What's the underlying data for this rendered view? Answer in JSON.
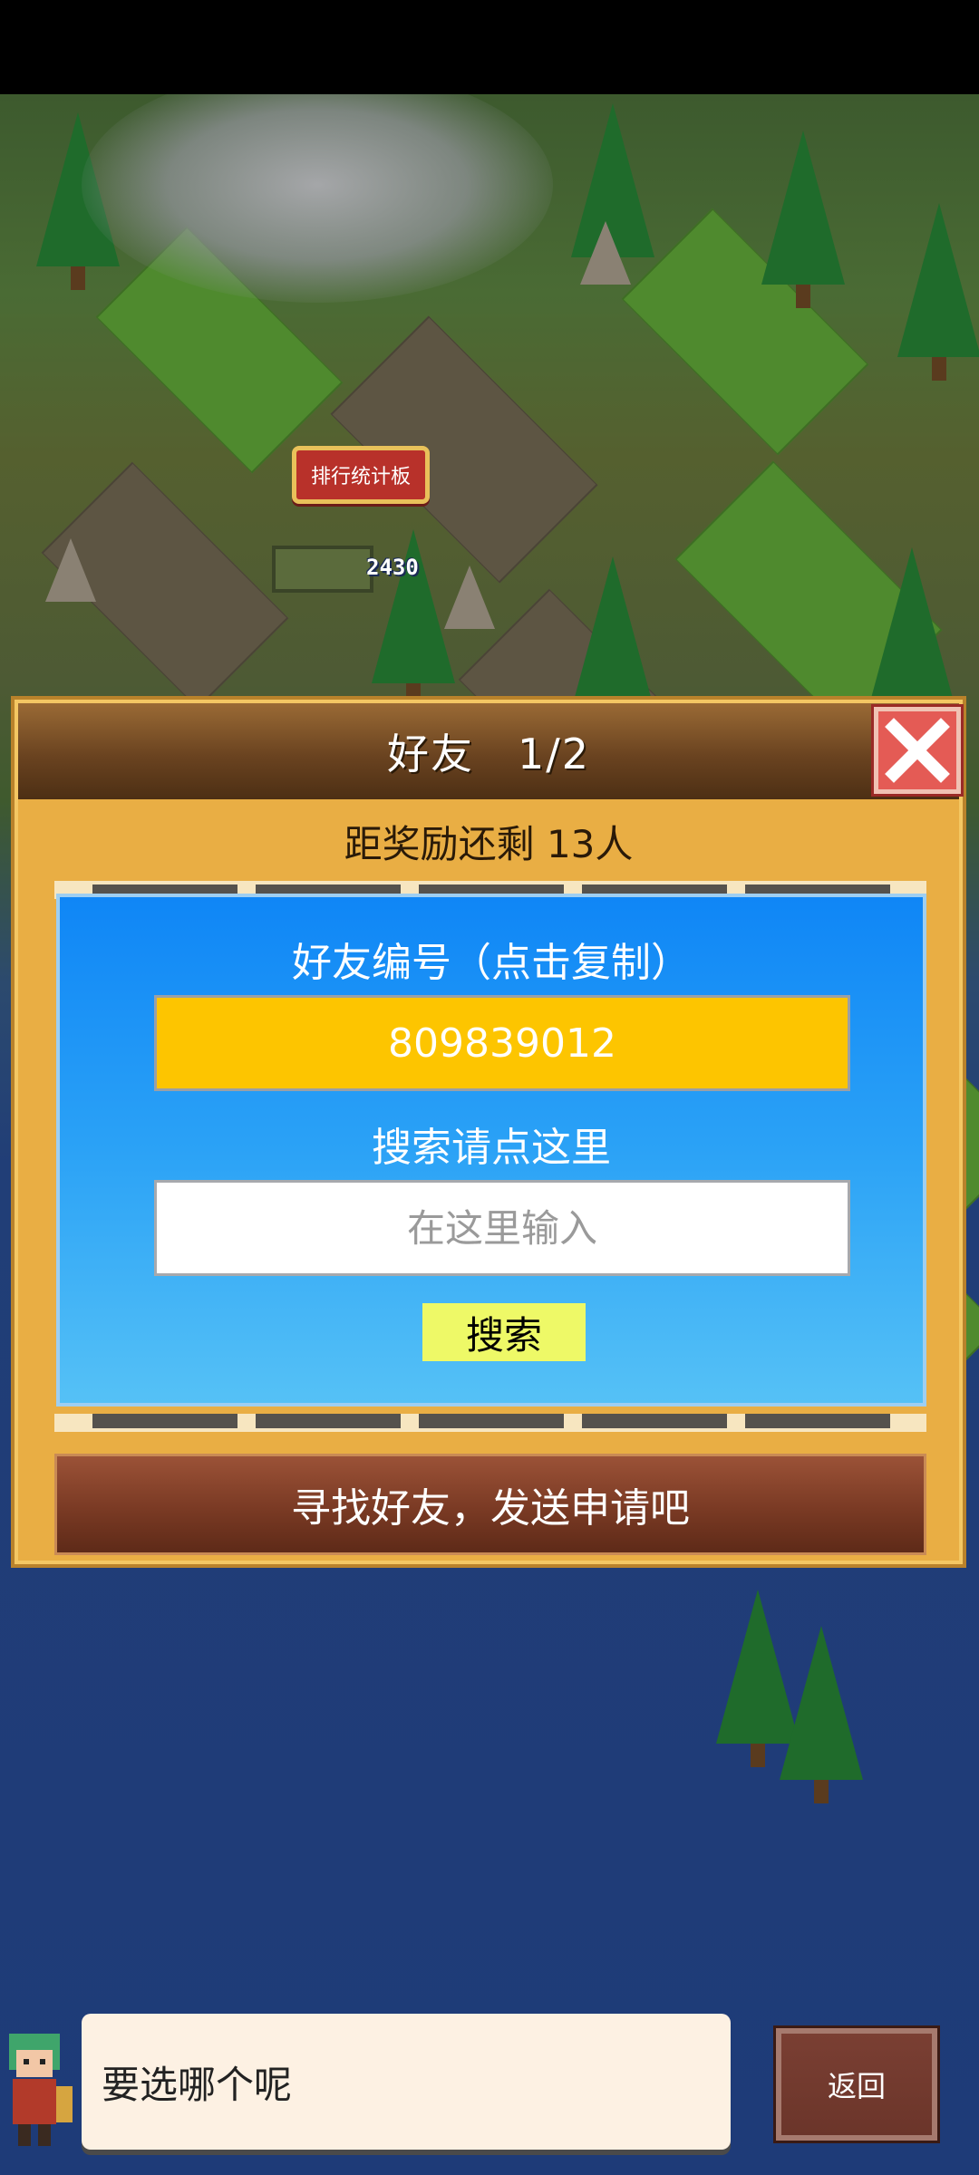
{
  "map": {
    "leaderboard_sign": "排行统计板",
    "score": "2430"
  },
  "dialog": {
    "title": "好友　1/2",
    "reward_text": "距奖励还剩 13人",
    "friend_id_label": "好友编号（点击复制）",
    "friend_id": "809839012",
    "search_label": "搜索请点这里",
    "search_placeholder": "在这里输入",
    "search_value": "",
    "search_button": "搜索",
    "find_friends_button": "寻找好友，发送申请吧"
  },
  "bottom": {
    "speech": "要选哪个呢",
    "back_button": "返回"
  },
  "colors": {
    "dialog_bg": "#e9ae44",
    "panel_blue": "#1a8ff6",
    "friend_id_yellow": "#fdc500",
    "search_button": "#eef967",
    "close_red": "#e45b55",
    "find_friends_brown": "#7a3a24",
    "arrow_yellow": "#d6ef2a"
  },
  "icons": {
    "close": "close-icon",
    "prev": "arrow-left-icon",
    "next": "arrow-right-icon",
    "avatar": "character-avatar-icon"
  }
}
